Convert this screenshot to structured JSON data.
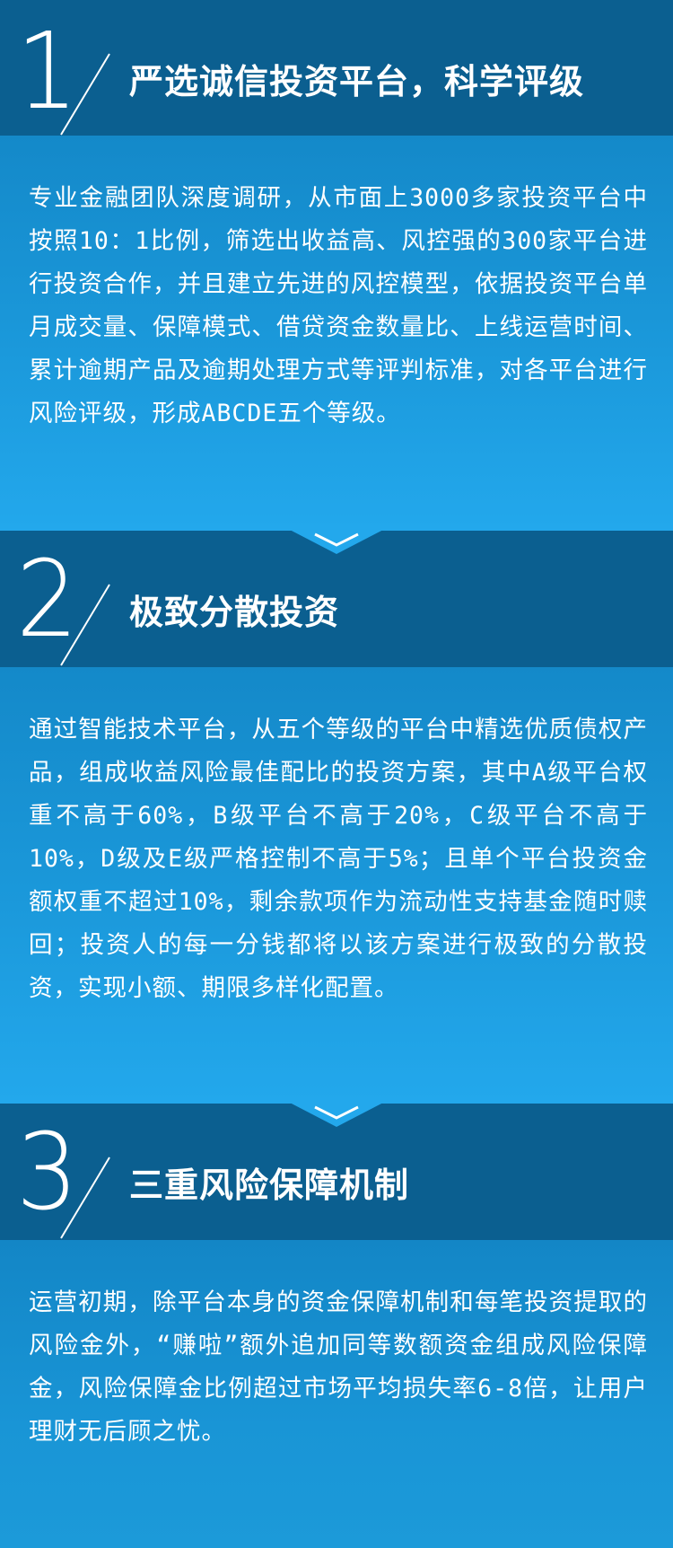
{
  "sections": [
    {
      "number": "1",
      "title": "严选诚信投资平台，科学评级",
      "paragraph": "专业金融团队深度调研，从市面上3000多家投资平台中按照10：1比例，筛选出收益高、风控强的300家平台进行投资合作，并且建立先进的风控模型，依据投资平台单月成交量、保障模式、借贷资金数量比、上线运营时间、累计逾期产品及逾期处理方式等评判标准，对各平台进行风险评级，形成ABCDE五个等级。"
    },
    {
      "number": "2",
      "title": "极致分散投资",
      "paragraph": "通过智能技术平台，从五个等级的平台中精选优质债权产品，组成收益风险最佳配比的投资方案，其中A级平台权重不高于60%，B级平台不高于20%，C级平台不高于10%，D级及E级严格控制不高于5%；且单个平台投资金额权重不超过10%，剩余款项作为流动性支持基金随时赎回；投资人的每一分钱都将以该方案进行极致的分散投资，实现小额、期限多样化配置。"
    },
    {
      "number": "3",
      "title": "三重风险保障机制",
      "paragraph": "运营初期，除平台本身的资金保障机制和每笔投资提取的风险金外，“赚啦”额外追加同等数额资金组成风险保障金，风险保障金比例超过市场平均损失率6-8倍，让用户理财无后顾之忧。"
    }
  ],
  "icons": [
    "chevron-down-icon",
    "chevron-down-icon"
  ],
  "colors": {
    "header_bg": "#0b5f90",
    "body_top": "#1489c9",
    "body_bottom": "#23a8ec",
    "text": "#ffffff"
  }
}
